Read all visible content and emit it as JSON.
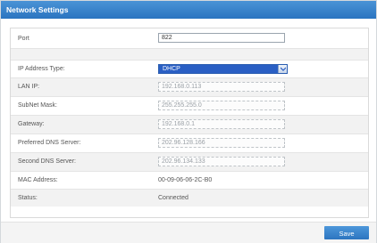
{
  "window": {
    "title": "Network Settings"
  },
  "form": {
    "port": {
      "label": "Port",
      "value": "822"
    },
    "ip_address_type": {
      "label": "IP Address Type:",
      "value": "DHCP"
    },
    "lan_ip": {
      "label": "LAN IP:",
      "value": "192.168.0.113"
    },
    "subnet_mask": {
      "label": "SubNet Mask:",
      "value": "255.255.255.0"
    },
    "gateway": {
      "label": "Gateway:",
      "value": "192.168.0.1"
    },
    "preferred_dns": {
      "label": "Preferred DNS Server:",
      "value": "202.96.128.166"
    },
    "second_dns": {
      "label": "Second DNS Server:",
      "value": "202.96.134.133"
    },
    "mac_address": {
      "label": "MAC Address:",
      "value": "00-09-06-06-2C-B0"
    },
    "status": {
      "label": "Status:",
      "value": "Connected"
    }
  },
  "footer": {
    "save_label": "Save"
  },
  "icons": {
    "dropdown": "chevron-down-icon"
  },
  "colors": {
    "accent": "#2a74c0",
    "select_bg": "#2a5fc4"
  }
}
